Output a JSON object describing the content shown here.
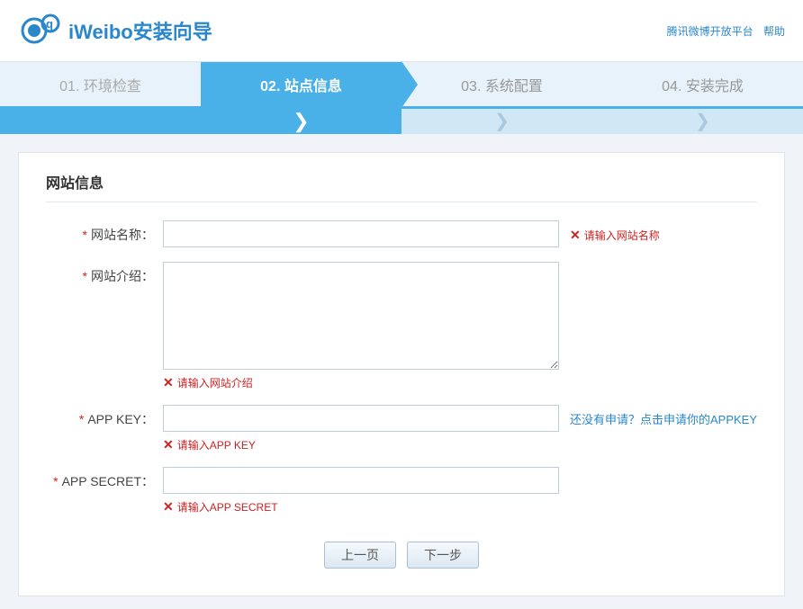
{
  "header": {
    "logo_text": "iWeibo安装向导",
    "links": {
      "platform": "腾讯微博开放平台",
      "help": "帮助"
    }
  },
  "steps": [
    {
      "id": "step1",
      "label": "01. 环境检查",
      "state": "done"
    },
    {
      "id": "step2",
      "label": "02. 站点信息",
      "state": "active"
    },
    {
      "id": "step3",
      "label": "03. 系统配置",
      "state": "upcoming"
    },
    {
      "id": "step4",
      "label": "04. 安装完成",
      "state": "upcoming"
    }
  ],
  "section": {
    "title": "网站信息"
  },
  "form": {
    "site_name": {
      "label": "网站名称：",
      "placeholder": "",
      "value": "",
      "error": "请输入网站名称"
    },
    "site_intro": {
      "label": "网站介绍：",
      "placeholder": "",
      "value": "",
      "error": "请输入网站介绍"
    },
    "app_key": {
      "label": "APP KEY：",
      "placeholder": "",
      "value": "",
      "error": "请输入APP KEY",
      "hint": "还没有申请？点击申请你的APPKEY"
    },
    "app_secret": {
      "label": "APP SECRET：",
      "placeholder": "",
      "value": "",
      "error": "请输入APP SECRET"
    }
  },
  "buttons": {
    "prev": "上一页",
    "next": "下一步"
  },
  "icons": {
    "error_x": "✕",
    "chevron": "❯"
  }
}
